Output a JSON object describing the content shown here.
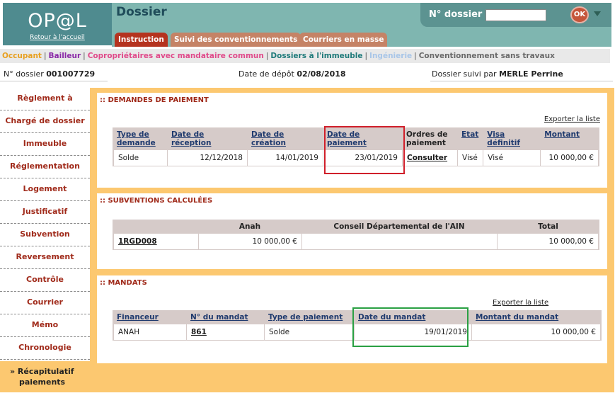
{
  "header": {
    "logo": "OP@L",
    "back_link": "Retour à l'accueil",
    "title": "Dossier",
    "dossier_label": "N° dossier",
    "dossier_value": "",
    "ok_label": "OK"
  },
  "tabs": [
    "Instruction",
    "Suivi des conventionnements",
    "Courriers en masse"
  ],
  "subnav": [
    {
      "label": "Occupant",
      "color": "#e8a020"
    },
    {
      "label": "Bailleur",
      "color": "#8b2aa8"
    },
    {
      "label": "Copropriétaires avec mandataire commun",
      "color": "#e04a8a"
    },
    {
      "label": "Dossiers à l'immeuble",
      "color": "#1f7a7a"
    },
    {
      "label": "Ingénierie",
      "color": "#a9c6e8"
    },
    {
      "label": "Conventionnement sans travaux",
      "color": "#6a6a6a"
    }
  ],
  "info": {
    "dossier_label": "N° dossier",
    "dossier_value": "001007729",
    "depot_label": "Date de dépôt",
    "depot_value": "02/08/2018",
    "suivi_label": "Dossier suivi par",
    "suivi_value": "MERLE Perrine"
  },
  "sidebar": [
    "Règlement à",
    "Chargé de dossier",
    "Immeuble",
    "Réglementation",
    "Logement",
    "Justificatif",
    "Subvention",
    "Reversement",
    "Contrôle",
    "Courrier",
    "Mémo",
    "Chronologie"
  ],
  "sidebar_active": [
    "» Récapitulatif",
    "paiements"
  ],
  "demandes": {
    "title": ":: DEMANDES DE PAIEMENT",
    "export": "Exporter la liste",
    "headers": [
      [
        "Type de",
        "demande"
      ],
      [
        "Date de",
        "réception"
      ],
      [
        "Date de",
        "création"
      ],
      [
        "Date de",
        "paiement"
      ],
      [
        "Ordres de",
        "paiement"
      ],
      [
        "Etat",
        ""
      ],
      [
        "Visa",
        "définitif"
      ],
      [
        "Montant",
        ""
      ]
    ],
    "row": [
      "Solde",
      "12/12/2018",
      "14/01/2019",
      "23/01/2019",
      "Consulter",
      "Visé",
      "Visé",
      "10 000,00 €"
    ]
  },
  "subventions": {
    "title": ":: SUBVENTIONS CALCULÉES",
    "headers": [
      "",
      "Anah",
      "Conseil Départemental de l'AIN",
      "Total"
    ],
    "row": [
      "1RGD008",
      "10 000,00 €",
      "",
      "10 000,00 €"
    ]
  },
  "mandats": {
    "title": ":: MANDATS",
    "export": "Exporter la liste",
    "headers": [
      "Financeur",
      "N° du mandat",
      "Type de paiement",
      "Date du mandat",
      "Montant du mandat"
    ],
    "row": [
      "ANAH",
      "861",
      "Solde",
      "19/01/2019",
      "10 000,00 €"
    ]
  },
  "colors": {
    "accent_orange": "#fcc870",
    "header_teal": "#7fb6b0",
    "logo_teal": "#4f8b8f",
    "label_red": "#a02a1a",
    "highlight_red": "#d01f2a",
    "highlight_green": "#2aa043"
  }
}
